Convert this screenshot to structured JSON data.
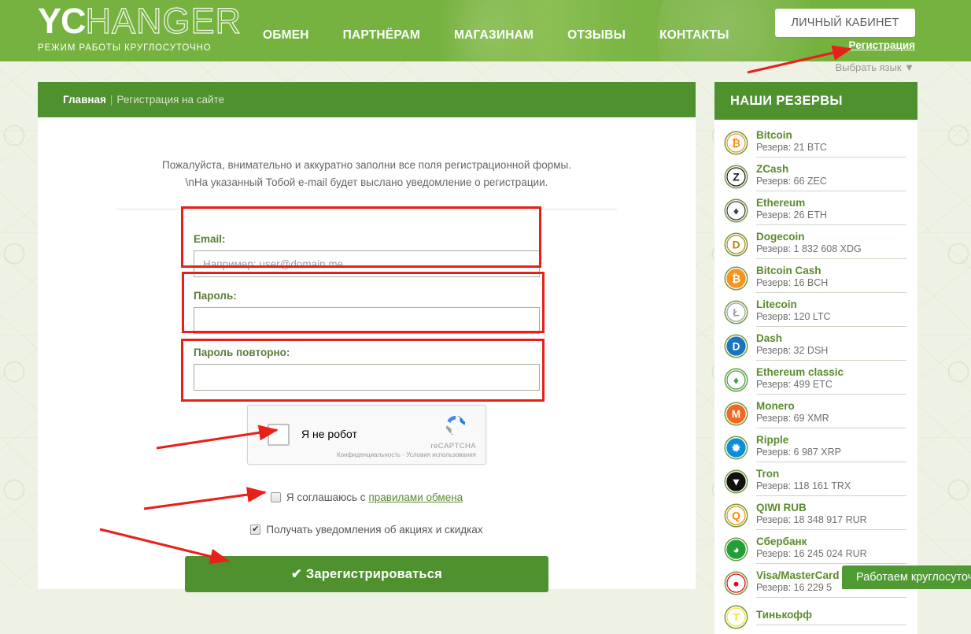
{
  "header": {
    "logo_bold": "YC",
    "logo_light": "HANGER",
    "logo_sub": "РЕЖИМ РАБОТЫ КРУГЛОСУТОЧНО",
    "nav": [
      {
        "label": "ОБМЕН"
      },
      {
        "label": "ПАРТНЁРАМ"
      },
      {
        "label": "МАГАЗИНАМ"
      },
      {
        "label": "ОТЗЫВЫ"
      },
      {
        "label": "КОНТАКТЫ"
      }
    ],
    "cabinet_button": "ЛИЧНЫЙ КАБИНЕТ",
    "register_link": "Регистрация",
    "language_picker": "Выбрать язык ▼"
  },
  "breadcrumb": {
    "home": "Главная",
    "separator": "|",
    "current": "Регистрация на сайте"
  },
  "intro": {
    "line1": "Пожалуйста, внимательно и аккуратно заполни все поля регистрационной формы.",
    "line2": "\\nНа указанный Тобой e-mail будет выслано уведомление о регистрации."
  },
  "form": {
    "email": {
      "label": "Email:",
      "placeholder": "Например: user@domain.me",
      "value": ""
    },
    "password": {
      "label": "Пароль:",
      "placeholder": "",
      "value": ""
    },
    "password_repeat": {
      "label": "Пароль повторно:",
      "placeholder": "",
      "value": ""
    },
    "recaptcha": {
      "label": "Я не робот",
      "brand": "reCAPTCHA",
      "terms": "Конфиденциальность - Условия использования",
      "checked": false
    },
    "agree": {
      "text": "Я соглашаюсь с",
      "link": "правилами обмена",
      "checked": false
    },
    "promo": {
      "text": "Получать уведомления об акциях и скидках",
      "checked": true
    },
    "submit_label": "Зарегистрироваться",
    "submit_icon": "check-icon"
  },
  "reserves": {
    "title": "НАШИ РЕЗЕРВЫ",
    "items": [
      {
        "name": "Bitcoin",
        "amount": "Резерв: 21 BTC",
        "icon": "bitcoin-icon",
        "symbol": "₿",
        "fg": "#f7931a",
        "bg": "#ffffff"
      },
      {
        "name": "ZCash",
        "amount": "Резерв: 66 ZEC",
        "icon": "zcash-icon",
        "symbol": "Z",
        "fg": "#1a1a1a",
        "bg": "#ffffff"
      },
      {
        "name": "Ethereum",
        "amount": "Резерв: 26 ETH",
        "icon": "ethereum-icon",
        "symbol": "♦",
        "fg": "#3c3c3d",
        "bg": "#ffffff"
      },
      {
        "name": "Dogecoin",
        "amount": "Резерв: 1 832 608 XDG",
        "icon": "dogecoin-icon",
        "symbol": "D",
        "fg": "#b8860b",
        "bg": "#ffffff"
      },
      {
        "name": "Bitcoin Cash",
        "amount": "Резерв: 16 BCH",
        "icon": "bitcoincash-icon",
        "symbol": "₿",
        "fg": "#ffffff",
        "bg": "#f7941d"
      },
      {
        "name": "Litecoin",
        "amount": "Резерв: 120 LTC",
        "icon": "litecoin-icon",
        "symbol": "Ł",
        "fg": "#9a9fb0",
        "bg": "#ffffff"
      },
      {
        "name": "Dash",
        "amount": "Резерв: 32 DSH",
        "icon": "dash-icon",
        "symbol": "D",
        "fg": "#ffffff",
        "bg": "#1c75bc"
      },
      {
        "name": "Ethereum classic",
        "amount": "Резерв: 499 ETC",
        "icon": "ethclassic-icon",
        "symbol": "♦",
        "fg": "#3a9c4a",
        "bg": "#ffffff"
      },
      {
        "name": "Monero",
        "amount": "Резерв: 69 XMR",
        "icon": "monero-icon",
        "symbol": "M",
        "fg": "#ffffff",
        "bg": "#f26822"
      },
      {
        "name": "Ripple",
        "amount": "Резерв: 6 987 XRP",
        "icon": "ripple-icon",
        "symbol": "✹",
        "fg": "#ffffff",
        "bg": "#0a8fd6"
      },
      {
        "name": "Tron",
        "amount": "Резерв: 118 161 TRX",
        "icon": "tron-icon",
        "symbol": "▼",
        "fg": "#ffffff",
        "bg": "#111111"
      },
      {
        "name": "QIWI RUB",
        "amount": "Резерв: 18 348 917 RUR",
        "icon": "qiwi-icon",
        "symbol": "Q",
        "fg": "#ff8c00",
        "bg": "#ffffff"
      },
      {
        "name": "Сбербанк",
        "amount": "Резерв: 16 245 024 RUR",
        "icon": "sberbank-icon",
        "symbol": "◕",
        "fg": "#ffffff",
        "bg": "#21a038"
      },
      {
        "name": "Visa/MasterCard RUB",
        "amount": "Резерв: 16 229 5",
        "icon": "visa-mc-icon",
        "symbol": "●",
        "fg": "#eb001b",
        "bg": "#ffffff"
      },
      {
        "name": "Тинькофф",
        "amount": "",
        "icon": "tinkoff-icon",
        "symbol": "Т",
        "fg": "#ffdd2d",
        "bg": "#ffffff"
      }
    ]
  },
  "toast": {
    "text": "Работаем круглосуточн"
  },
  "colors": {
    "header_green": "#76b23f",
    "panel_green": "#4f902f",
    "link_green": "#5b8a2d",
    "label_green": "#5b7e36",
    "annotation_red": "#e8201a",
    "page_bg": "#eef2e4"
  }
}
